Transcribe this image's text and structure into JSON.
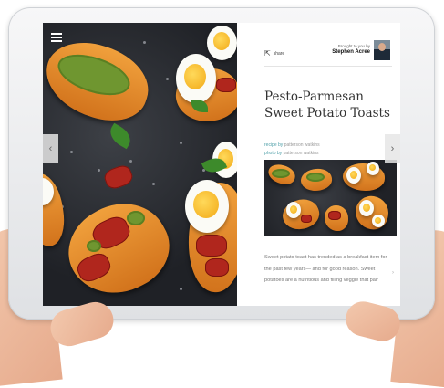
{
  "article": {
    "title": "Pesto-Parmesan Sweet Potato Toasts",
    "recipe_label": "recipe by",
    "recipe_author": "patterson watkins",
    "photo_label": "photo by",
    "photo_author": "patterson watkins",
    "body": "Sweet potato toast has trended as a breakfast item for the past few years— and for good reason. Sweet potatoes are a nutritious and filling veggie that pair"
  },
  "toolbar": {
    "share_label": "share",
    "brought_by": "Brought to you by",
    "sponsor_name": "Stephen Acree"
  },
  "icons": {
    "menu": "hamburger-icon",
    "share": "share-icon",
    "prev": "chevron-left-icon",
    "next": "chevron-right-icon",
    "scroll": "chevron-down-icon"
  },
  "colors": {
    "credit_label": "#4e9fa8",
    "title": "#333333",
    "tablet_frame": "#ebedef"
  }
}
